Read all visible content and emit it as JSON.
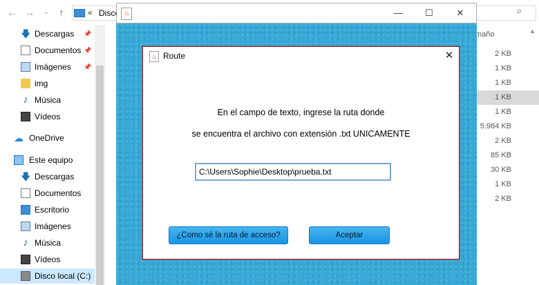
{
  "explorer": {
    "address_breadcrumb": "Disco",
    "address_chevron": "«",
    "size_header": "maño",
    "nav_items": [
      {
        "label": "Descargas",
        "icon": "download-icon",
        "pinned": true
      },
      {
        "label": "Documentos",
        "icon": "document-icon",
        "pinned": true
      },
      {
        "label": "Imágenes",
        "icon": "images-icon",
        "pinned": true
      },
      {
        "label": "img",
        "icon": "folder-icon",
        "pinned": false
      },
      {
        "label": "Música",
        "icon": "music-icon",
        "pinned": false
      },
      {
        "label": "Vídeos",
        "icon": "video-icon",
        "pinned": false
      },
      {
        "label": "OneDrive",
        "icon": "cloud-icon",
        "pinned": false
      },
      {
        "label": "Este equipo",
        "icon": "computer-icon",
        "pinned": false
      },
      {
        "label": "Descargas",
        "icon": "download-icon",
        "pinned": false
      },
      {
        "label": "Documentos",
        "icon": "document-icon",
        "pinned": false
      },
      {
        "label": "Escritorio",
        "icon": "desktop-icon",
        "pinned": false
      },
      {
        "label": "Imágenes",
        "icon": "images-icon",
        "pinned": false
      },
      {
        "label": "Música",
        "icon": "music-icon",
        "pinned": false
      },
      {
        "label": "Vídeos",
        "icon": "video-icon",
        "pinned": false
      },
      {
        "label": "Disco local (C:)",
        "icon": "disk-icon",
        "pinned": false
      }
    ],
    "sizes": [
      "2 KB",
      "1 KB",
      "1 KB",
      "1 KB",
      "1 KB",
      "5.984 KB",
      "2 KB",
      "85 KB",
      "30 KB",
      "1 KB",
      "2 KB"
    ]
  },
  "frame": {
    "minimize_glyph": "—",
    "maximize_glyph": "☐",
    "close_glyph": "✕"
  },
  "dialog": {
    "title": "Route",
    "close_glyph": "✕",
    "line1": "En el campo de texto, ingrese la ruta donde",
    "line2": "se encuentra el archivo con extensión .txt UNICAMENTE",
    "path_value": "C:\\Users\\Sophie\\Desktop\\prueba.txt",
    "help_button": "¿Como sé la ruta de acceso?",
    "ok_button": "Aceptar"
  },
  "colors": {
    "frame_background": "#35a9d8",
    "button_blue": "#1696e4",
    "selection": "#cce8ff"
  }
}
